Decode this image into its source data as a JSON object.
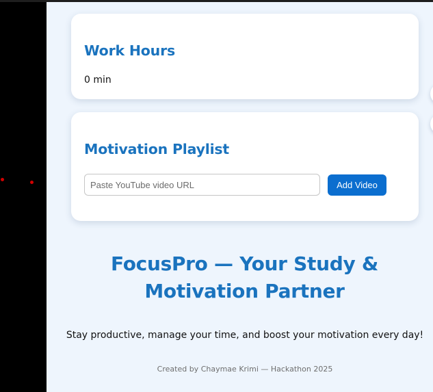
{
  "work_hours": {
    "title": "Work Hours",
    "value": "0 min"
  },
  "playlist": {
    "title": "Motivation Playlist",
    "input_placeholder": "Paste YouTube video URL",
    "input_value": "",
    "add_button_label": "Add Video"
  },
  "hero": {
    "title": "FocusPro — Your Study & Motivation Partner",
    "tagline": "Stay productive, manage your time, and boost your motivation every day!"
  },
  "footer": {
    "credit": "Created by Chaymae Krimi — Hackathon 2025"
  },
  "colors": {
    "accent": "#1a73be",
    "button": "#0b6ecf",
    "page_background": "#eef5fd",
    "card_background": "#ffffff"
  }
}
